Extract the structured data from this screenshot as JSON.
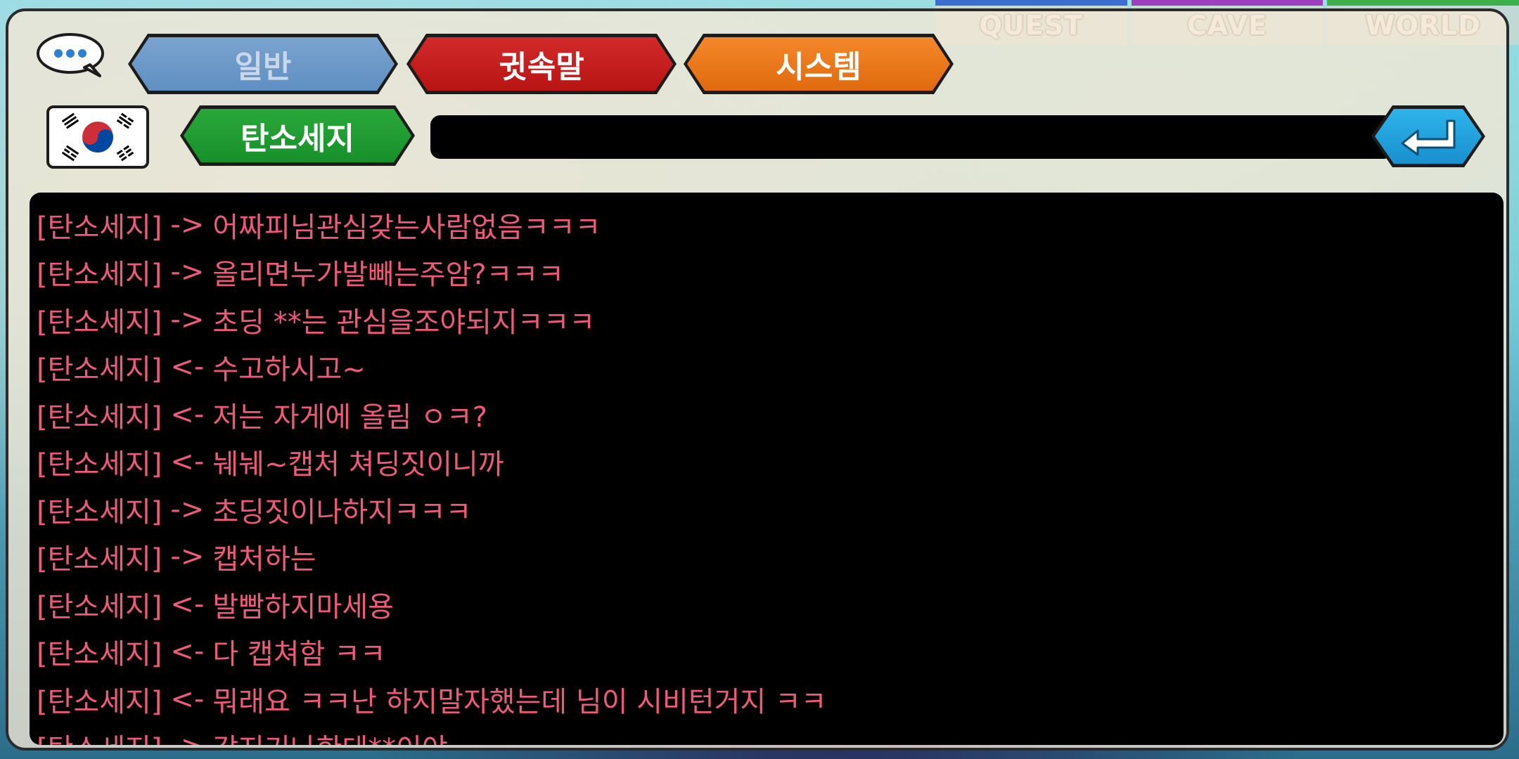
{
  "top_tabs": [
    "QUEST",
    "CAVE",
    "WORLD"
  ],
  "chat": {
    "tabs": {
      "general": "일반",
      "whisper": "귓속말",
      "system": "시스템"
    },
    "target_name": "탄소세지",
    "input_value": "",
    "messages": [
      {
        "sender": "[탄소세지]",
        "dir": "->",
        "text": "어짜피님관심갖는사람없음ㅋㅋㅋ"
      },
      {
        "sender": "[탄소세지]",
        "dir": "->",
        "text": "올리면누가발빼는주암?ㅋㅋㅋ"
      },
      {
        "sender": "[탄소세지]",
        "dir": "->",
        "text": "초딩 **는  관심을조야되지ㅋㅋㅋ"
      },
      {
        "sender": "[탄소세지]",
        "dir": "<-",
        "text": "수고하시고~"
      },
      {
        "sender": "[탄소세지]",
        "dir": "<-",
        "text": "저는 자게에 올림 ㅇㅋ?"
      },
      {
        "sender": "[탄소세지]",
        "dir": "<-",
        "text": "눼눼~캡처 쳐딩짓이니까"
      },
      {
        "sender": "[탄소세지]",
        "dir": "->",
        "text": "초딩짓이나하지ㅋㅋㅋ"
      },
      {
        "sender": "[탄소세지]",
        "dir": "->",
        "text": "캡처하는"
      },
      {
        "sender": "[탄소세지]",
        "dir": "<-",
        "text": "발빰하지마세용"
      },
      {
        "sender": "[탄소세지]",
        "dir": "<-",
        "text": "다 캡쳐함 ㅋㅋ"
      },
      {
        "sender": "[탄소세지]",
        "dir": "<-",
        "text": "뭐래요 ㅋㅋ난 하지말자했는데 님이 시비턴거지 ㅋㅋ"
      },
      {
        "sender": "[탄소세지]",
        "dir": "->",
        "text": "같지기나한데**이야"
      }
    ]
  },
  "colors": {
    "message_text": "#ee5a78",
    "general_tab": "#6b97c7",
    "whisper_tab": "#c81c1c",
    "system_tab": "#ea7418",
    "target_pill": "#1f9a30",
    "send_button": "#22a2dc"
  },
  "icons": {
    "chat": "speech-bubble-icon",
    "flag": "korea-flag-icon",
    "send": "enter-arrow-icon"
  }
}
